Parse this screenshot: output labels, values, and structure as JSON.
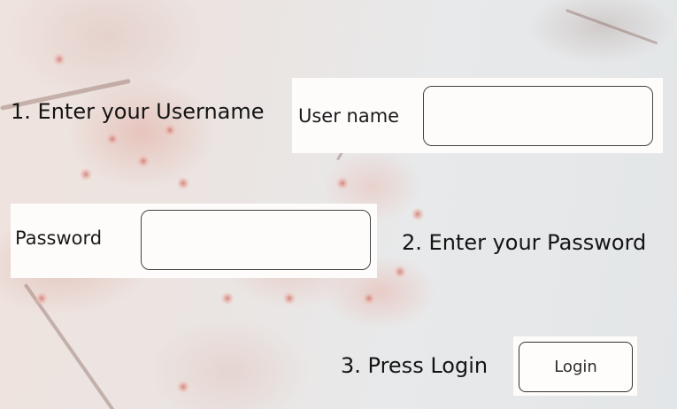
{
  "steps": {
    "step1": "1. Enter your Username",
    "step2": "2. Enter your Password",
    "step3": "3. Press Login"
  },
  "form": {
    "username_label": "User name",
    "password_label": "Password",
    "username_value": "",
    "password_value": "",
    "login_label": "Login"
  },
  "colors": {
    "field_border": "#444444",
    "panel_background": "#fefcfb"
  }
}
